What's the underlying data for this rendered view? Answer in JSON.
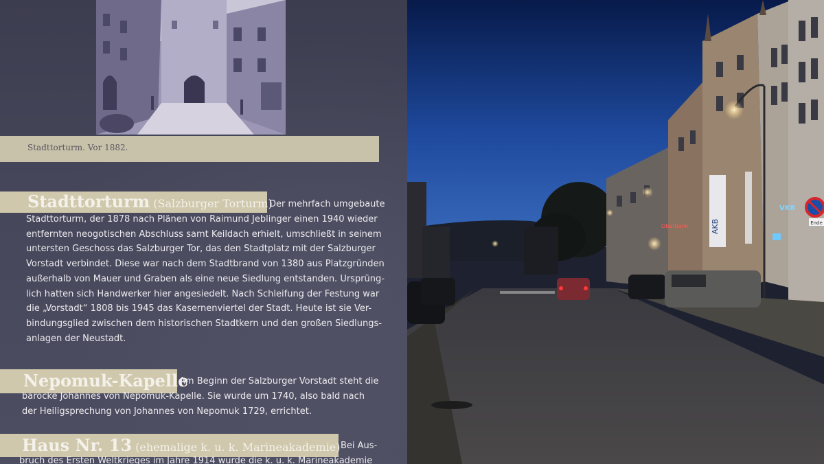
{
  "sign": {
    "caption": "Stadttorturm. Vor 1882.",
    "sections": [
      {
        "title": "Stadttorturm",
        "subtitle": "(Salzburger Torturm)",
        "lines": [
          "Der mehrfach umgebaute",
          "Stadttorturm, der 1878 nach Plänen von Raimund Jeblinger einen 1940 wieder",
          "entfernten neogotischen Abschluss samt Keildach erhielt, umschließt in seinem",
          "untersten Geschoss das Salzburger Tor, das den Stadtplatz mit der Salzburger",
          "Vorstadt verbindet. Diese war nach dem Stadtbrand von 1380 aus Platzgründen",
          "außerhalb von Mauer und Graben als eine neue Siedlung entstanden. Ursprüng-",
          "lich hatten sich Handwerker hier angesiedelt. Nach Schleifung der Festung war",
          "die „Vorstadt“ 1808 bis 1945 das Kasernenviertel der Stadt. Heute ist sie Ver-",
          "bindungsglied zwischen dem historischen Stadtkern und den großen Siedlungs-",
          "anlagen der Neustadt."
        ]
      },
      {
        "title": "Nepomuk-Kapelle",
        "subtitle": "",
        "lines": [
          "Am Beginn der Salzburger Vorstadt steht die",
          "barocke Johannes von Nepomuk-Kapelle. Sie wurde um 1740, also bald nach",
          "der Heiligsprechung von Johannes von Nepomuk 1729, errichtet."
        ]
      },
      {
        "title": "Haus Nr. 13",
        "subtitle": "(ehemalige k. u. k. Marineakademie)",
        "lines": [
          "Bei Aus-",
          "bruch des Ersten Weltkrieges im Jahre 1914 wurde die k. u. k. Marineakademie"
        ]
      }
    ]
  },
  "street": {
    "signs": {
      "vkb": "VKB",
      "akb": "AKB",
      "oberbank": "Oberbank",
      "ende": "Ende"
    }
  },
  "colors": {
    "sky_top": "#0a1f52",
    "sky_bottom": "#2f5db0",
    "sign_bg": "#45455a",
    "highlight": "#cfc8ac"
  }
}
